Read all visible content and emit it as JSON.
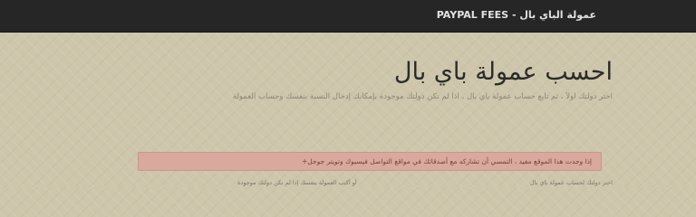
{
  "navbar": {
    "brand": "عمولة الباي بال - PAYPAL FEES"
  },
  "header": {
    "title": "احسب عمولة باي بال",
    "subtitle": "اختر دولتك أولاً ، ثم تابع حساب عمولة باي بال ، اذا لم تكن دولتك موجودة بإمكانك إدخال النسبة بنفسك وحساب العمولة"
  },
  "alert": {
    "text": "إذا وجدت هذا الموقع مفيد ، التمسي أن تشاركه مع أصدقائك في مواقع التواصل فيسبوك وتويتر جوجل+"
  },
  "footer": {
    "left_text": "أو أكتب العمولة بنفسك إذا لم تكن دولتك موجودة",
    "right_text": "اختر دولتك لحساب عمولة باي بال"
  },
  "colors": {
    "navbar_bg": "#262626",
    "page_bg": "#cdc6ab",
    "alert_bg": "#d9a99d",
    "alert_text": "#7a3f35"
  }
}
